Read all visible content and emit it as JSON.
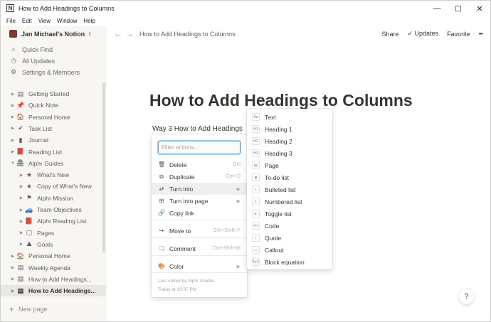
{
  "window": {
    "title": "How to Add Headings to Columns",
    "app_icon": "N",
    "controls": [
      "—",
      "☐",
      "✕"
    ]
  },
  "menubar": [
    "File",
    "Edit",
    "View",
    "Window",
    "Help"
  ],
  "sidebar": {
    "workspace": "Jan Michael's Notion",
    "nav": [
      {
        "icon": "search-icon",
        "glyph": "⌕",
        "label": "Quick Find"
      },
      {
        "icon": "clock-icon",
        "glyph": "◷",
        "label": "All Updates"
      },
      {
        "icon": "gear-icon",
        "glyph": "⚙",
        "label": "Settings & Members"
      }
    ],
    "pages": [
      {
        "label": "Getting Started",
        "glyph": "▤",
        "indent": 0
      },
      {
        "label": "Quick Note",
        "glyph": "📌",
        "indent": 0
      },
      {
        "label": "Personal Home",
        "glyph": "🏠",
        "indent": 0
      },
      {
        "label": "Task List",
        "glyph": "✔",
        "indent": 0
      },
      {
        "label": "Journal",
        "glyph": "▮",
        "indent": 0
      },
      {
        "label": "Reading List",
        "glyph": "📕",
        "indent": 0
      },
      {
        "label": "Alphr Guides",
        "glyph": "🏯",
        "indent": 0,
        "open": true
      },
      {
        "label": "What's New",
        "glyph": "★",
        "indent": 1
      },
      {
        "label": "Copy of What's New",
        "glyph": "★",
        "indent": 1
      },
      {
        "label": "Alphr Mission",
        "glyph": "⚑",
        "indent": 1
      },
      {
        "label": "Team Objectives",
        "glyph": "🚙",
        "indent": 1
      },
      {
        "label": "Alphr Reading List",
        "glyph": "📕",
        "indent": 1
      },
      {
        "label": "Pages",
        "glyph": "▢",
        "indent": 1
      },
      {
        "label": "Goals",
        "glyph": "⛰",
        "indent": 1
      },
      {
        "label": "Personal Home",
        "glyph": "🏠",
        "indent": 0
      },
      {
        "label": "Weekly Agenda",
        "glyph": "▤",
        "indent": 0
      },
      {
        "label": "How to Add Headings...",
        "glyph": "▤",
        "indent": 0
      },
      {
        "label": "How to Add Headings...",
        "glyph": "▤",
        "indent": 0,
        "selected": true
      }
    ],
    "new_page": "New page"
  },
  "topbar": {
    "breadcrumb": "How to Add Headings to Columns",
    "share": "Share",
    "updates": "Updates",
    "favorite": "Favorite",
    "more": "•••"
  },
  "content": {
    "title": "How to Add Headings to Columns",
    "subline": "Way 3 How to Add Headings"
  },
  "action_menu": {
    "filter_placeholder": "Filter actions...",
    "items": [
      {
        "label": "Delete",
        "shortcut": "Del",
        "icon": "trash-icon",
        "glyph": "🗑"
      },
      {
        "label": "Duplicate",
        "shortcut": "Ctrl+D",
        "icon": "duplicate-icon",
        "glyph": "⧉"
      },
      {
        "label": "Turn into",
        "shortcut": "▶",
        "icon": "turn-into-icon",
        "glyph": "⇄",
        "hover": true
      },
      {
        "label": "Turn into page",
        "shortcut": "▶",
        "icon": "turn-into-page-icon",
        "glyph": "⊞"
      },
      {
        "label": "Copy link",
        "shortcut": "",
        "icon": "link-icon",
        "glyph": "🔗"
      },
      {
        "label": "Move to",
        "shortcut": "Ctrl+Shift+P",
        "icon": "move-icon",
        "glyph": "↪"
      },
      {
        "label": "Comment",
        "shortcut": "Ctrl+Shift+M",
        "icon": "comment-icon",
        "glyph": "🗨"
      },
      {
        "label": "Color",
        "shortcut": "▶",
        "icon": "color-icon",
        "glyph": "🎨"
      }
    ],
    "edited_by": "Last edited by Alphr Guides",
    "edited_time": "Today at 10:37 PM"
  },
  "turn_into_menu": {
    "items": [
      {
        "label": "Text",
        "glyph": "Aa"
      },
      {
        "label": "Heading 1",
        "glyph": "H1"
      },
      {
        "label": "Heading 2",
        "glyph": "H2"
      },
      {
        "label": "Heading 3",
        "glyph": "H3"
      },
      {
        "label": "Page",
        "glyph": "▤"
      },
      {
        "label": "To-do list",
        "glyph": "■"
      },
      {
        "label": "Bulleted list",
        "glyph": "•"
      },
      {
        "label": "Numbered list",
        "glyph": "1."
      },
      {
        "label": "Toggle list",
        "glyph": "▸"
      },
      {
        "label": "Code",
        "glyph": "</>"
      },
      {
        "label": "Quote",
        "glyph": "|"
      },
      {
        "label": "Callout",
        "glyph": "▭"
      },
      {
        "label": "Block equation",
        "glyph": "TeX"
      }
    ]
  },
  "help": "?",
  "colors": {
    "sidebar_bg": "#f7f6f3",
    "text": "#37352f",
    "accent": "#2eaadc"
  }
}
